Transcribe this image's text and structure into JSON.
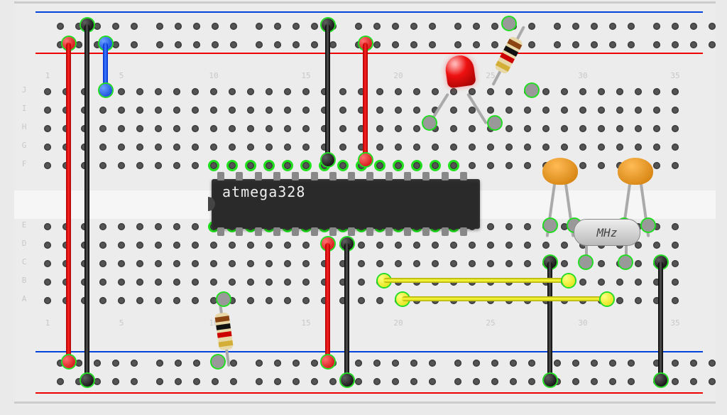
{
  "chip": {
    "label": "atmega328",
    "pins_per_side": 14
  },
  "crystal": {
    "label": "MHz"
  },
  "led": {
    "color": "red"
  },
  "row_labels_top": [
    "J",
    "I",
    "H",
    "G",
    "F"
  ],
  "row_labels_bot": [
    "E",
    "D",
    "C",
    "B",
    "A"
  ],
  "col_step_labels": [
    "1",
    "5",
    "10",
    "15",
    "20",
    "25",
    "30",
    "35"
  ],
  "components": {
    "resistor_led": {
      "bands": [
        "#8B4513",
        "#111",
        "#cc0000",
        "#d4af37"
      ]
    },
    "resistor_reset": {
      "bands": [
        "#8B4513",
        "#111",
        "#cc0000",
        "#d4af37"
      ]
    }
  },
  "wires": [
    {
      "id": "vcc-left",
      "color": "red"
    },
    {
      "id": "gnd-left",
      "color": "black"
    },
    {
      "id": "reset-blue",
      "color": "blue"
    },
    {
      "id": "vcc-mid",
      "color": "red"
    },
    {
      "id": "gnd-mid",
      "color": "black"
    },
    {
      "id": "vcc-mid2",
      "color": "red"
    },
    {
      "id": "gnd-mid2",
      "color": "black"
    },
    {
      "id": "gnd-cap1",
      "color": "black"
    },
    {
      "id": "gnd-cap2",
      "color": "black"
    },
    {
      "id": "xtal-y1",
      "color": "yellow"
    },
    {
      "id": "xtal-y2",
      "color": "yellow"
    }
  ],
  "colors": {
    "rail_pos": "#ee0000",
    "rail_neg": "#0044dd",
    "hole_hi": "#21e01e"
  }
}
